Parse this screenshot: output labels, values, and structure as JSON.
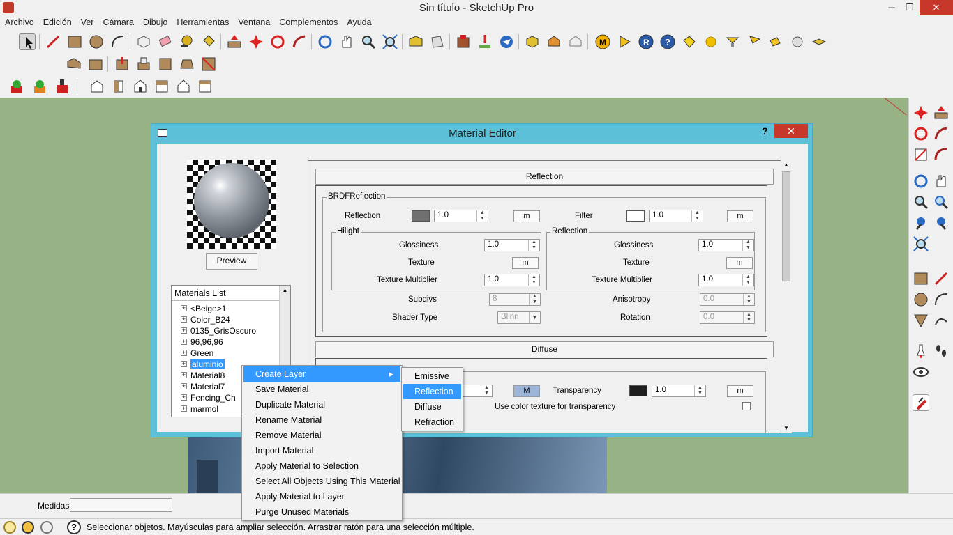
{
  "window": {
    "title": "Sin título - SketchUp Pro",
    "min": "─",
    "max": "❐",
    "close": "✕"
  },
  "menu": [
    "Archivo",
    "Edición",
    "Ver",
    "Cámara",
    "Dibujo",
    "Herramientas",
    "Ventana",
    "Complementos",
    "Ayuda"
  ],
  "dialog": {
    "title": "Material Editor",
    "help": "?",
    "close": "✕",
    "preview_button": "Preview",
    "materials_list_header": "Materials List",
    "materials": [
      "<Beige>1",
      "Color_B24",
      "0135_GrisOscuro",
      "96,96,96",
      "Green",
      "aluminio",
      "Material8",
      "Material7",
      "Fencing_Ch",
      "marmol"
    ],
    "selected_material": "aluminio",
    "sections": {
      "reflection": "Reflection",
      "diffuse": "Diffuse"
    },
    "brdf": {
      "group_label": "BRDFReflection",
      "reflection_label": "Reflection",
      "reflection_value": "1.0",
      "reflection_map": "m",
      "filter_label": "Filter",
      "filter_value": "1.0",
      "filter_map": "m",
      "hilight": {
        "label": "Hilight",
        "glossiness_label": "Glossiness",
        "glossiness_value": "1.0",
        "texture_label": "Texture",
        "texture_map": "m",
        "texmult_label": "Texture Multiplier",
        "texmult_value": "1.0"
      },
      "reflection_group": {
        "label": "Reflection",
        "glossiness_label": "Glossiness",
        "glossiness_value": "1.0",
        "texture_label": "Texture",
        "texture_map": "m",
        "texmult_label": "Texture Multiplier",
        "texmult_value": "1.0"
      },
      "subdivs_label": "Subdivs",
      "subdivs_value": "8",
      "anisotropy_label": "Anisotropy",
      "anisotropy_value": "0.0",
      "shader_type_label": "Shader Type",
      "shader_type_value": "Blinn",
      "rotation_label": "Rotation",
      "rotation_value": "0.0"
    },
    "diffuse": {
      "map_button": "M",
      "transparency_label": "Transparency",
      "transparency_value": "1.0",
      "transparency_map": "m",
      "use_color_texture_label": "Use color texture for transparency"
    }
  },
  "context_menu": {
    "items": [
      "Create Layer",
      "Save Material",
      "Duplicate Material",
      "Rename Material",
      "Remove Material",
      "Import Material",
      "Apply Material to Selection",
      "Select All Objects Using This Material",
      "Apply Material to Layer",
      "Purge Unused Materials"
    ],
    "submenu_arrow": "▸",
    "submenu": [
      "Emissive",
      "Reflection",
      "Diffuse",
      "Refraction"
    ],
    "highlighted_submenu": "Reflection"
  },
  "measure": {
    "label": "Medidas",
    "value": ""
  },
  "status": {
    "text": "Seleccionar objetos. Mayúsculas para ampliar selección. Arrastrar ratón para una selección múltiple."
  }
}
